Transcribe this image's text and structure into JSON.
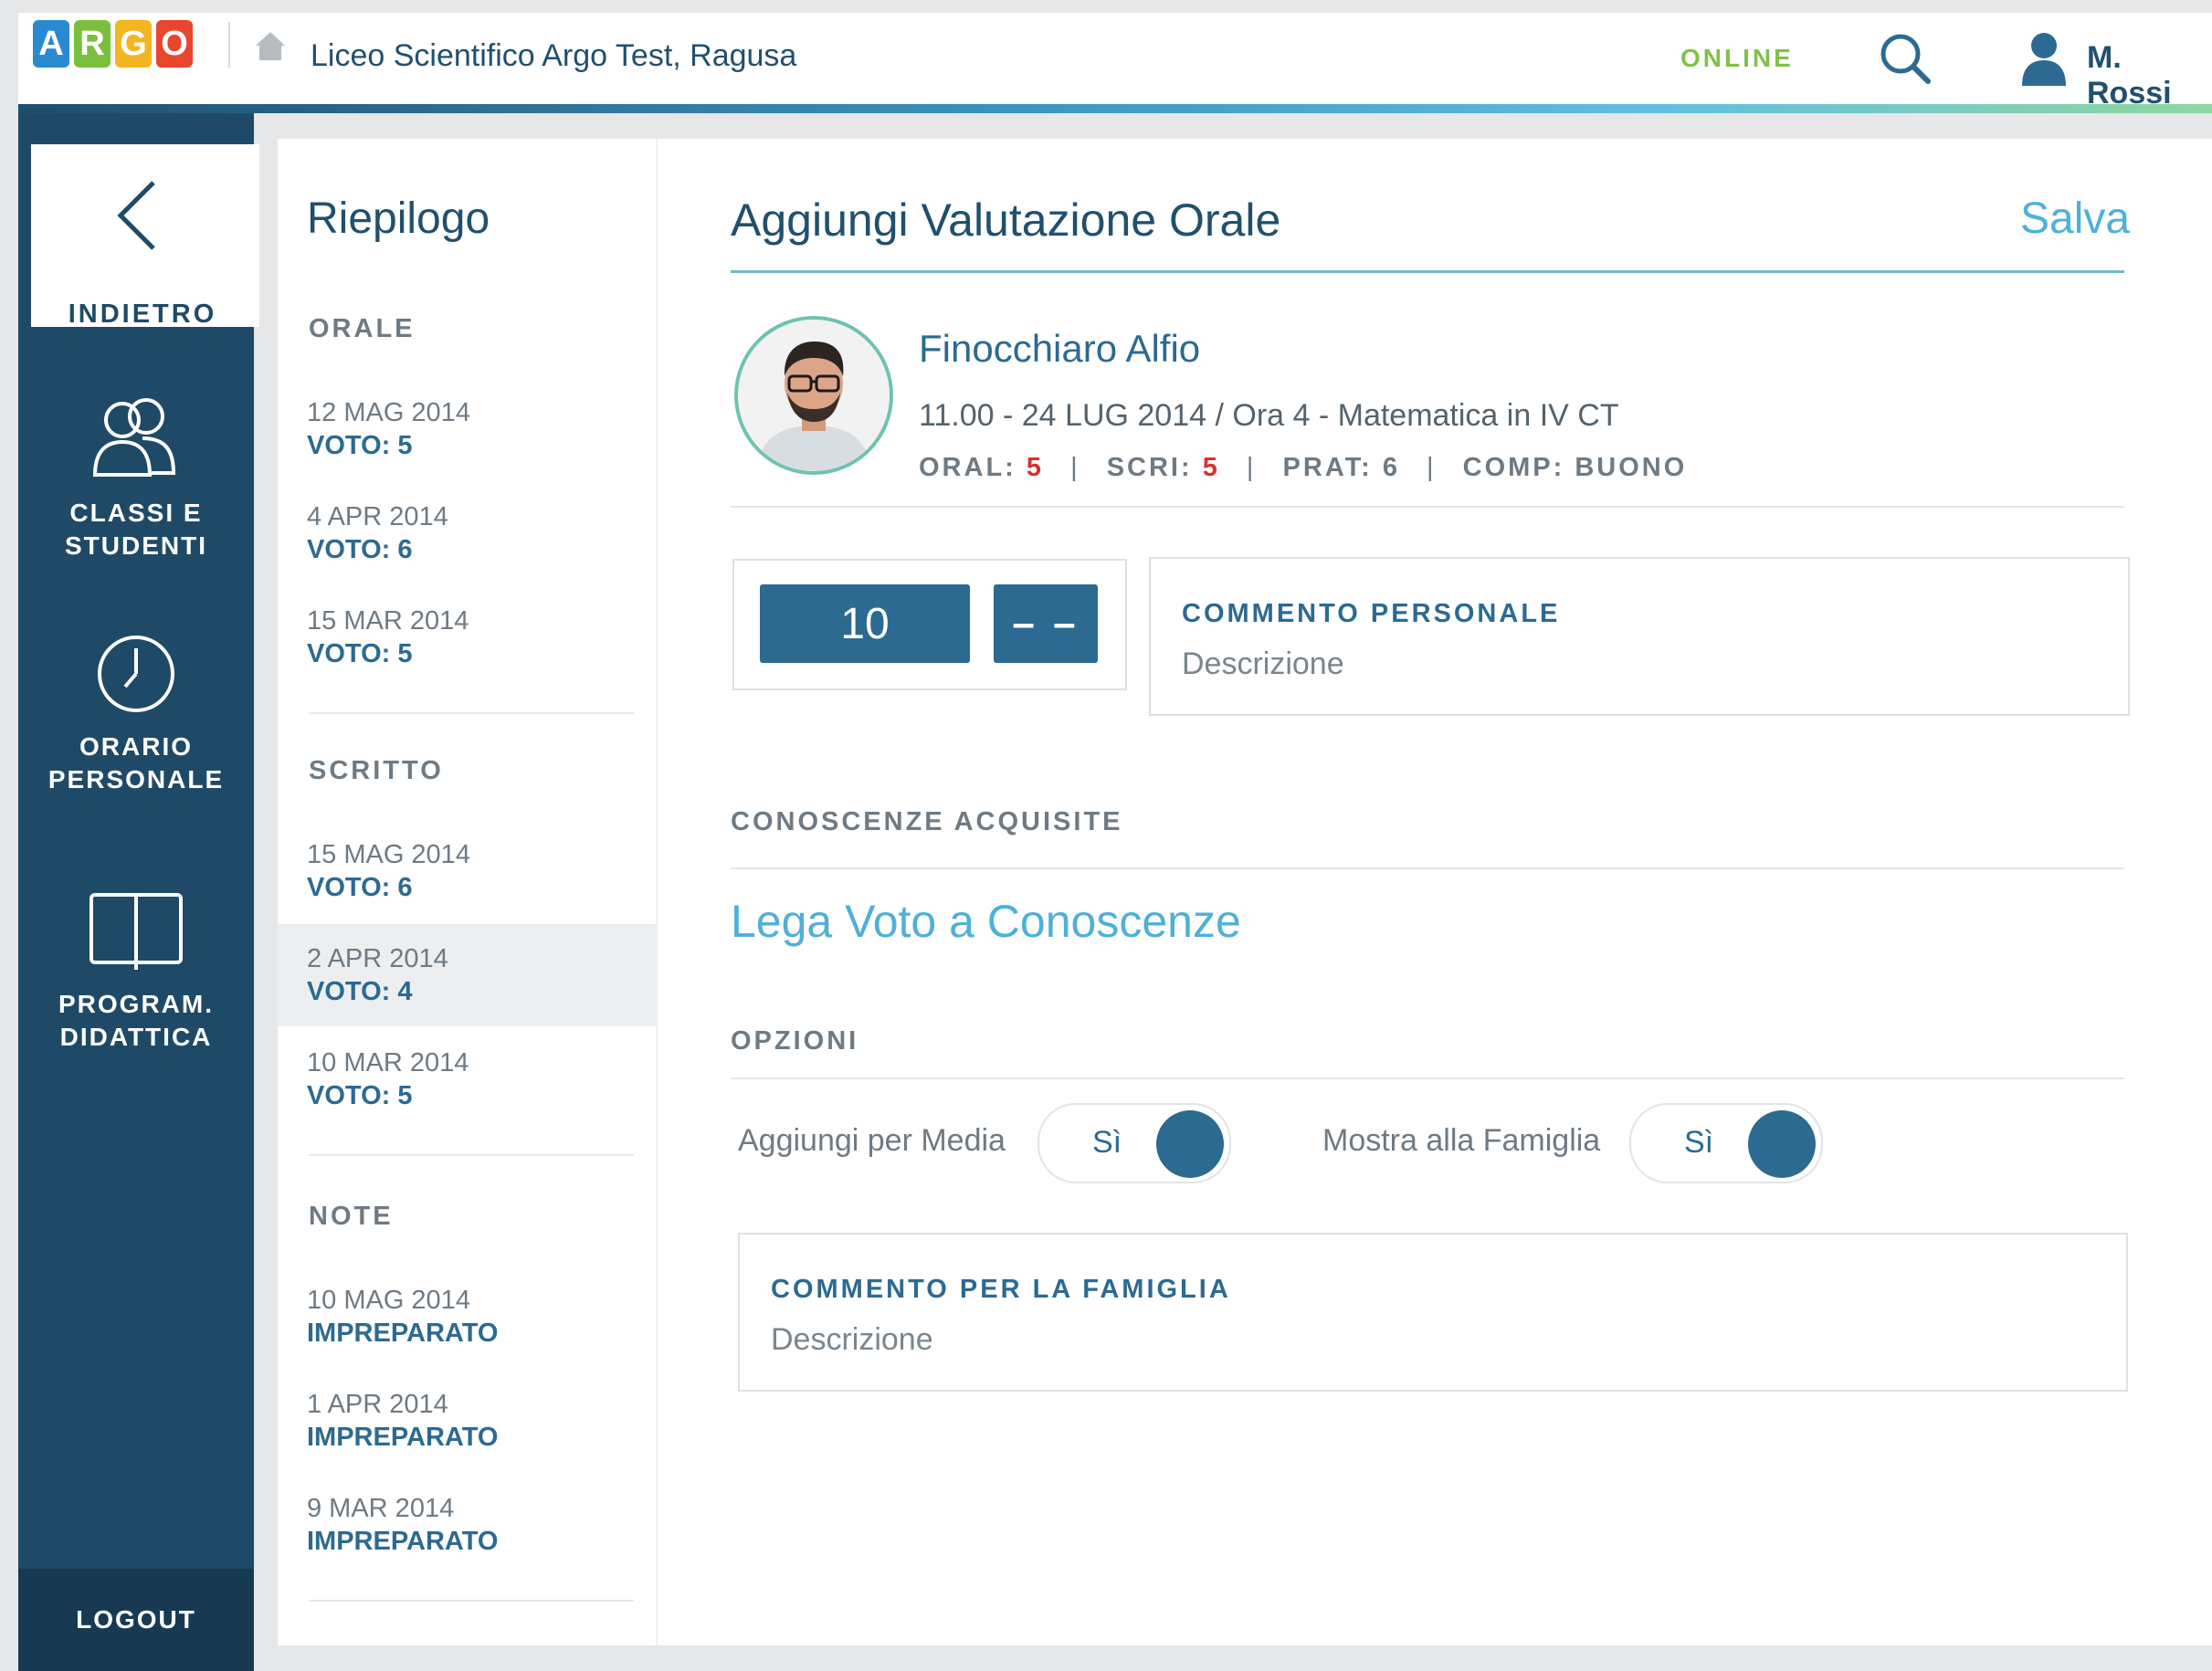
{
  "header": {
    "logo_letters": [
      "A",
      "R",
      "G",
      "O"
    ],
    "school": "Liceo Scientifico Argo Test, Ragusa",
    "status": "ONLINE",
    "user": "M. Rossi"
  },
  "sidebar": {
    "back": "INDIETRO",
    "items": [
      {
        "line1": "CLASSI E",
        "line2": "STUDENTI",
        "icon": "users-icon"
      },
      {
        "line1": "ORARIO",
        "line2": "PERSONALE",
        "icon": "clock-icon"
      },
      {
        "line1": "PROGRAM.",
        "line2": "DIDATTICA",
        "icon": "book-icon"
      }
    ],
    "logout": "LOGOUT"
  },
  "summary": {
    "title": "Riepilogo",
    "sections": [
      {
        "label": "ORALE",
        "entries": [
          {
            "date": "12 MAG 2014",
            "value": "VOTO: 5"
          },
          {
            "date": "4 APR 2014",
            "value": "VOTO: 6"
          },
          {
            "date": "15 MAR 2014",
            "value": "VOTO: 5"
          }
        ]
      },
      {
        "label": "SCRITTO",
        "entries": [
          {
            "date": "15 MAG 2014",
            "value": "VOTO: 6"
          },
          {
            "date": "2 APR 2014",
            "value": "VOTO: 4"
          },
          {
            "date": "10 MAR 2014",
            "value": "VOTO: 5"
          }
        ]
      },
      {
        "label": "NOTE",
        "entries": [
          {
            "date": "10 MAG 2014",
            "value": "IMPREPARATO"
          },
          {
            "date": "1 APR 2014",
            "value": "IMPREPARATO"
          },
          {
            "date": "9 MAR 2014",
            "value": "IMPREPARATO"
          }
        ]
      }
    ]
  },
  "main": {
    "title": "Aggiungi Valutazione Orale",
    "save": "Salva",
    "student": {
      "name": "Finocchiaro Alfio",
      "info": "11.00 - 24 LUG 2014 / Ora 4 - Matematica in IV CT",
      "oral_label": "ORAL:",
      "oral_value": "5",
      "scri_label": "SCRI:",
      "scri_value": "5",
      "prat": "PRAT: 6",
      "comp": "COMP: BUONO",
      "separator": "|"
    },
    "grade": {
      "value": "10",
      "modifier": "– –"
    },
    "personal_comment": {
      "title": "COMMENTO PERSONALE",
      "placeholder": "Descrizione"
    },
    "knowledge": {
      "title": "CONOSCENZE ACQUISITE",
      "link": "Lega Voto a Conoscenze"
    },
    "options": {
      "title": "OPZIONI",
      "average": {
        "label": "Aggiungi per Media",
        "value": "Sì"
      },
      "family": {
        "label": "Mostra alla Famiglia",
        "value": "Sì"
      }
    },
    "family_comment": {
      "title": "COMMENTO PER LA FAMIGLIA",
      "placeholder": "Descrizione"
    }
  },
  "colors": {
    "primary": "#2c6a92",
    "sidebar": "#1f4a67",
    "accent_link": "#4fb0d8",
    "online": "#7ec24a",
    "error_grade": "#d9312b"
  }
}
